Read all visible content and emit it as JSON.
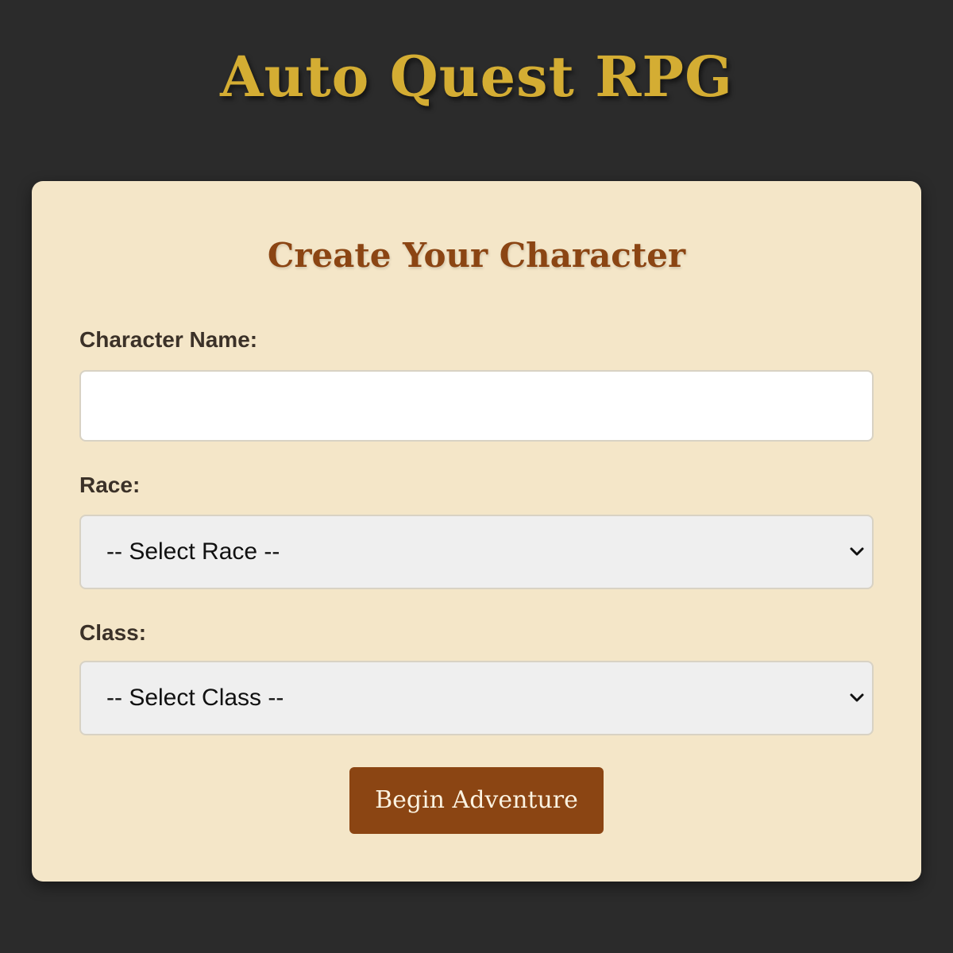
{
  "app": {
    "title": "Auto Quest RPG"
  },
  "form": {
    "heading": "Create Your Character",
    "name_field": {
      "label": "Character Name:",
      "value": "",
      "placeholder": ""
    },
    "race_field": {
      "label": "Race:",
      "selected": "-- Select Race --"
    },
    "class_field": {
      "label": "Class:",
      "selected": "-- Select Class --"
    },
    "submit_label": "Begin Adventure"
  },
  "colors": {
    "page_background": "#2b2b2b",
    "title_gold": "#d4ad33",
    "card_background": "#f4e6c8",
    "accent_brown": "#8b4513",
    "label_text": "#3b3128"
  },
  "icons": {
    "select_arrow": "chevron-down-icon"
  }
}
